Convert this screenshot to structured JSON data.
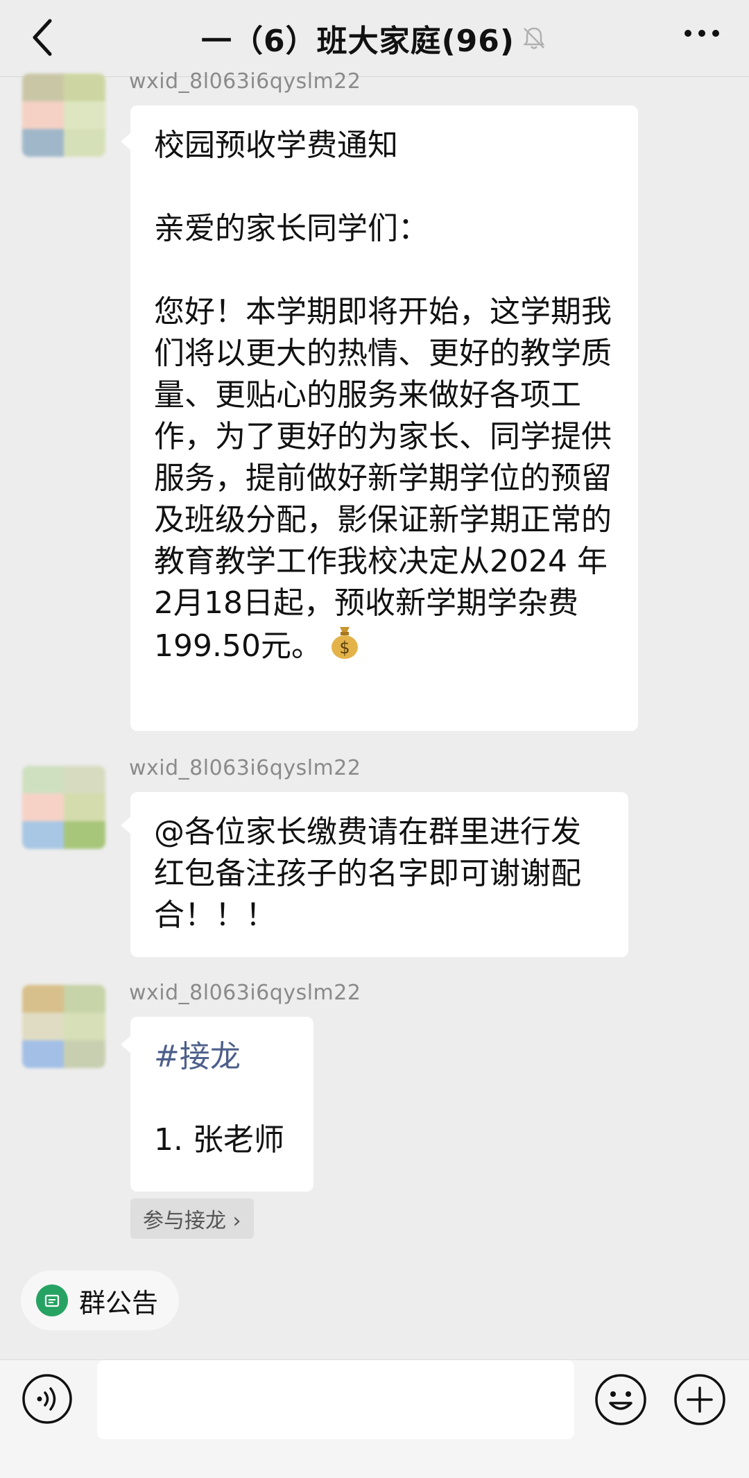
{
  "header": {
    "title": "一（6）班大家庭(96)",
    "back_icon": "chevron-left-icon",
    "mute_icon": "bell-off-icon",
    "more_icon": "more-dots-icon"
  },
  "messages": [
    {
      "sender": "wxid_8l063i6qyslm22",
      "paragraphs": [
        "校园预收学费通知",
        "亲爱的家长同学们：",
        "您好！本学期即将开始，这学期我们将以更大的热情、更好的教学质量、更贴心的服务来做好各项工作，为了更好的为家长、同学提供服务，提前做好新学期学位的预留及班级分配，影保证新学期正常的教育教学工作我校决定从2024 年2月18日起，预收新学期学杂费199.50元。"
      ],
      "emoji": "money-bag-icon"
    },
    {
      "sender": "wxid_8l063i6qyslm22",
      "text": "@各位家长缴费请在群里进行发红包备注孩子的名字即可谢谢配合！！！"
    },
    {
      "sender": "wxid_8l063i6qyslm22",
      "hashtag": "#接龙",
      "item": "1. 张老师",
      "join_label": "参与接龙 ›"
    }
  ],
  "announcement": {
    "label": "群公告",
    "icon": "announcement-icon"
  },
  "input_bar": {
    "voice_icon": "voice-icon",
    "emoji_icon": "emoji-icon",
    "plus_icon": "plus-icon",
    "value": ""
  },
  "colors": {
    "background": "#ededed",
    "bubble": "#ffffff",
    "accent": "#26a363",
    "hashtag": "#4d5f8a"
  }
}
